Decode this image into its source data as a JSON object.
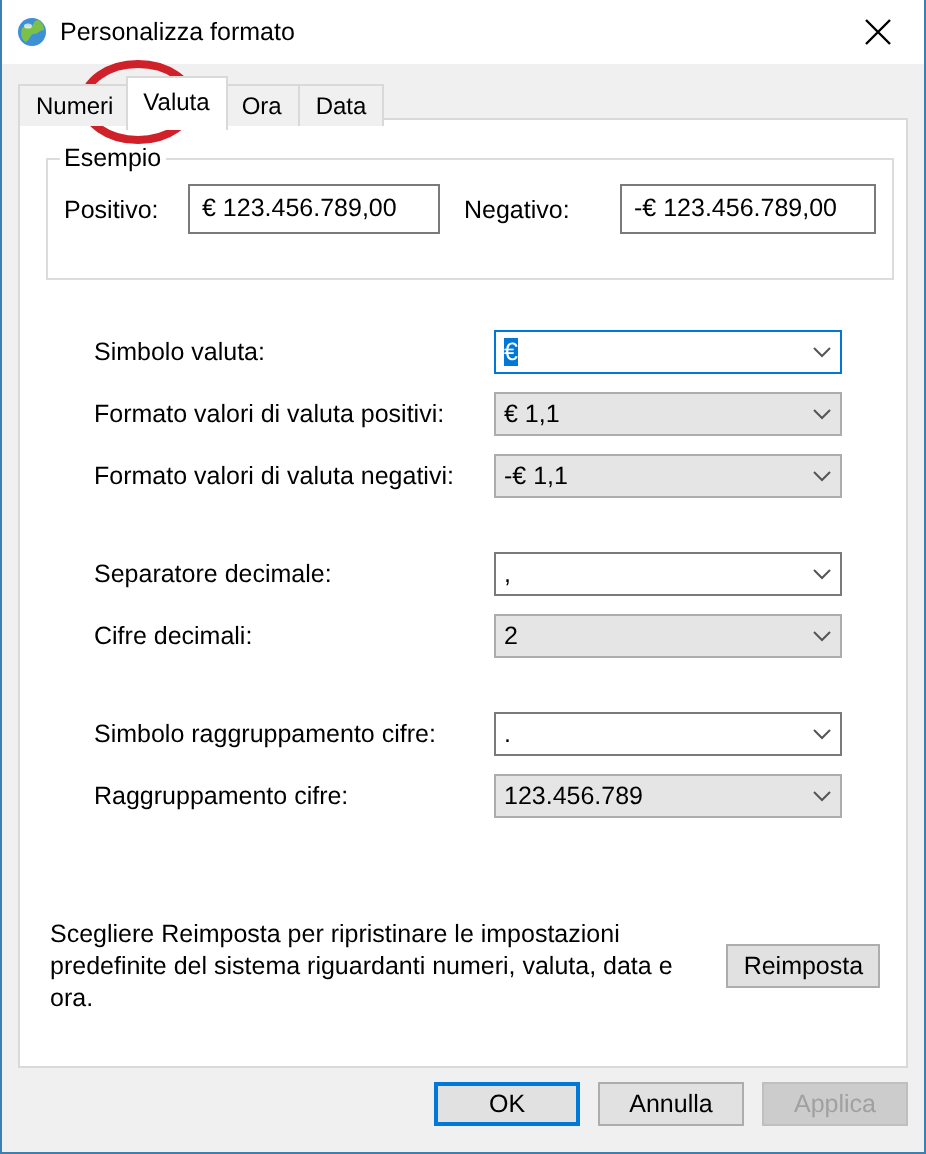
{
  "window": {
    "title": "Personalizza formato"
  },
  "tabs": [
    {
      "label": "Numeri",
      "selected": false
    },
    {
      "label": "Valuta",
      "selected": true
    },
    {
      "label": "Ora",
      "selected": false
    },
    {
      "label": "Data",
      "selected": false
    }
  ],
  "annotation": {
    "kind": "circle",
    "color": "#d0202a"
  },
  "example": {
    "title": "Esempio",
    "positive_label": "Positivo:",
    "positive_value": "€ 123.456.789,00",
    "negative_label": "Negativo:",
    "negative_value": "-€ 123.456.789,00"
  },
  "groups": [
    [
      {
        "label": "Simbolo valuta:",
        "value": "€",
        "kind": "editable",
        "focused": true
      },
      {
        "label": "Formato valori di valuta positivi:",
        "value": "€ 1,1",
        "kind": "list",
        "focused": false
      },
      {
        "label": "Formato valori di valuta negativi:",
        "value": "-€ 1,1",
        "kind": "list",
        "focused": false
      }
    ],
    [
      {
        "label": "Separatore decimale:",
        "value": ",",
        "kind": "editable",
        "focused": false
      },
      {
        "label": "Cifre decimali:",
        "value": "2",
        "kind": "list",
        "focused": false
      }
    ],
    [
      {
        "label": "Simbolo raggruppamento cifre:",
        "value": ".",
        "kind": "editable",
        "focused": false
      },
      {
        "label": "Raggruppamento cifre:",
        "value": "123.456.789",
        "kind": "list",
        "focused": false
      }
    ]
  ],
  "reset": {
    "text": "Scegliere Reimposta per ripristinare le impostazioni predefinite del sistema riguardanti numeri, valuta, data e ora.",
    "button": "Reimposta"
  },
  "buttons": [
    {
      "label": "OK",
      "default": true,
      "disabled": false
    },
    {
      "label": "Annulla",
      "default": false,
      "disabled": false
    },
    {
      "label": "Applica",
      "default": false,
      "disabled": true
    }
  ]
}
